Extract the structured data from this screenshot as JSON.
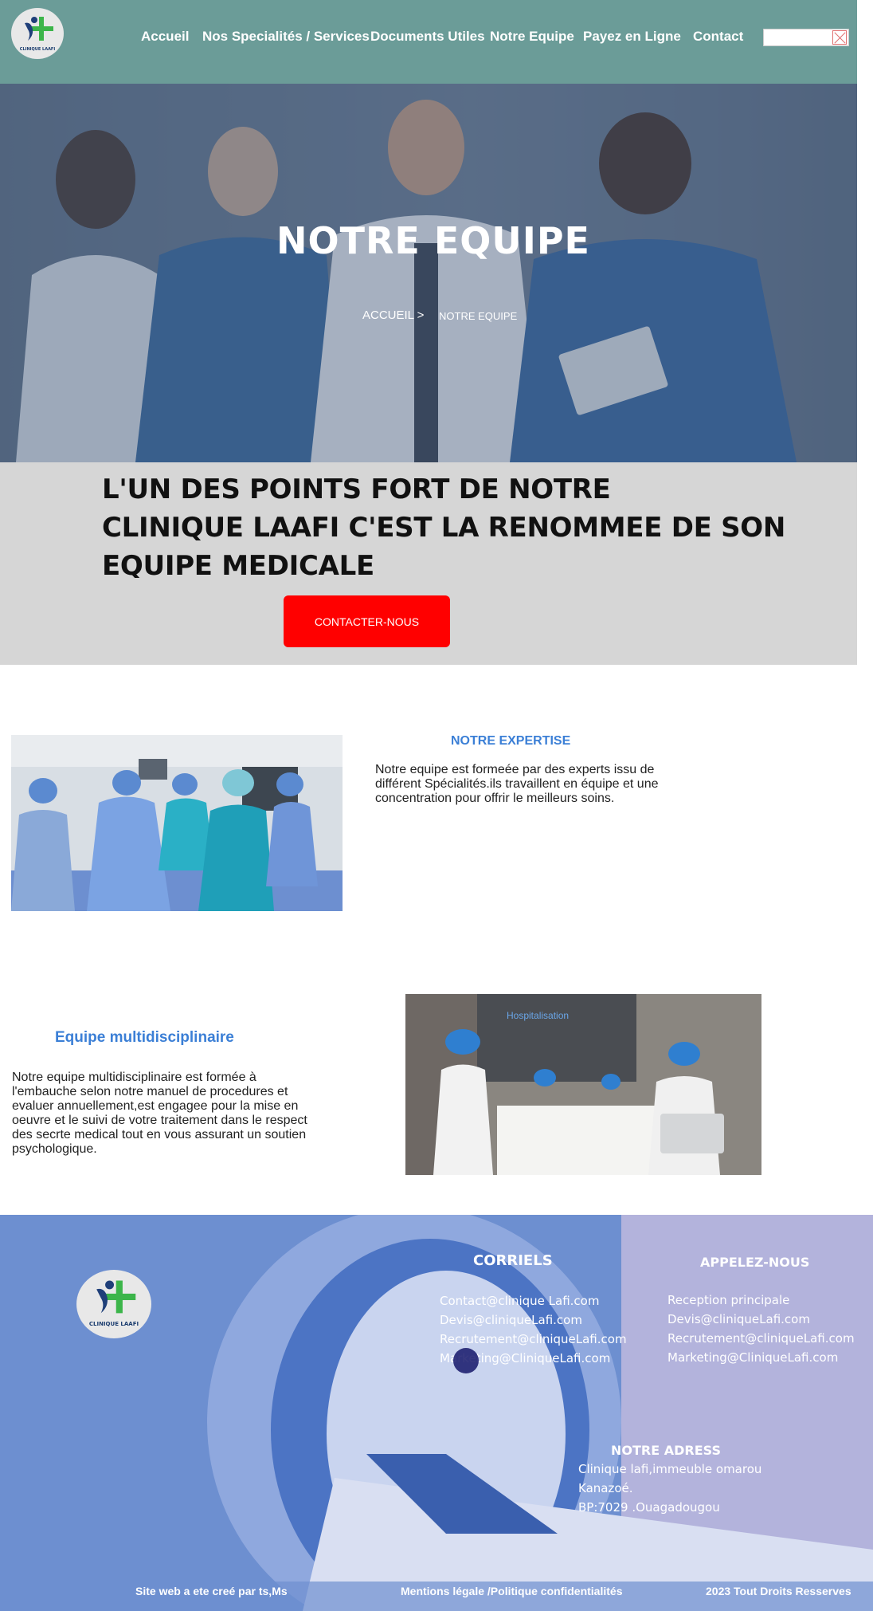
{
  "header": {
    "logo_text": "CLINIQUE LAAFI",
    "nav": [
      "Accueil",
      "Nos Specialités / Services",
      "Documents Utiles",
      "Notre Equipe",
      "Payez en Ligne",
      "Contact"
    ],
    "search": {
      "value": "",
      "placeholder": ""
    }
  },
  "hero": {
    "title": "NOTRE EQUIPE",
    "breadcrumb_home": "ACCUEIL >",
    "breadcrumb_current": "NOTRE EQUIPE"
  },
  "banner": {
    "lines": [
      "L'UN DES POINTS  FORT DE NOTRE",
      "CLINIQUE LAAFI C'EST LA RENOMMEE DE  SON",
      " EQUIPE MEDICALE"
    ],
    "button": "CONTACTER-NOUS"
  },
  "expertise": {
    "title": "NOTRE EXPERTISE",
    "text_lines": [
      "Notre equipe est formeée par des experts issu de",
      "différent Spécialités.ils travaillent en équipe et une",
      "concentration pour offrir le meilleurs soins."
    ]
  },
  "multi": {
    "title": "Equipe multidisciplinaire",
    "text_lines": [
      "Notre equipe multidisciplinaire est formée à",
      "l'embauche selon notre manuel de procedures et",
      "evaluer annuellement,est engagee pour la mise en",
      "oeuvre et le suivi de votre traitement dans le respect",
      "des secrte medical tout en vous assurant un soutien",
      "psychologique."
    ],
    "photo_sign": "Hospitalisation"
  },
  "footer": {
    "logo_text": "CLINIQUE LAAFI",
    "emails_title": "CORRIELS",
    "emails": [
      "Contact@clinique Lafi.com",
      "Devis@cliniqueLafi.com",
      "Recrutement@cliniqueLafi.com",
      "Marketing@CliniqueLafi.com"
    ],
    "call_title": "APPELEZ-NOUS",
    "call": [
      "Reception principale",
      "Devis@cliniqueLafi.com",
      "Recrutement@cliniqueLafi.com",
      "Marketing@CliniqueLafi.com"
    ],
    "address_title": "NOTRE ADRESS",
    "address": [
      "Clinique lafi,immeuble omarou",
      "Kanazoé.",
      "BP:7029 .Ouagadougou"
    ],
    "credit": "Site web a ete creé par ts,Ms",
    "legal": "Mentions légale /Politique confidentialités",
    "rights": "2023 Tout Droits Resserves"
  },
  "colors": {
    "header_bg": "#6b9c98",
    "banner_bg": "#d6d6d6",
    "cta_red": "#ff0000",
    "section_title_blue": "#3b7fd6",
    "footer_blue": "#6d8fd0",
    "footer_lavender": "#b3b3dc"
  },
  "icons": [
    "close-icon",
    "logo-icon"
  ]
}
